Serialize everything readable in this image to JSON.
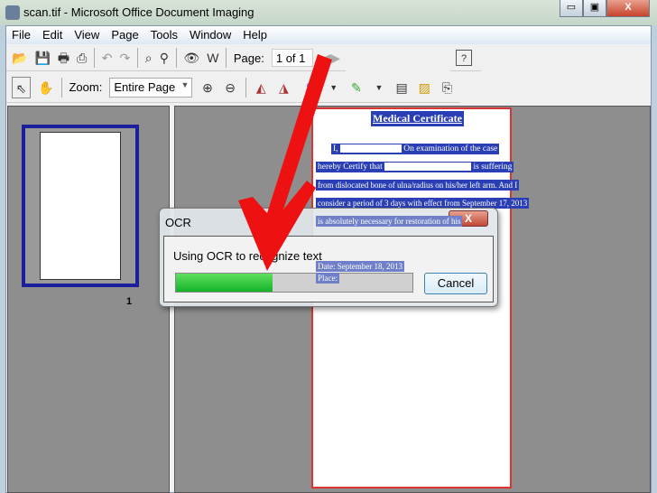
{
  "window": {
    "title": "scan.tif - Microsoft Office Document Imaging",
    "min": "▭",
    "max": "▣",
    "close": "X"
  },
  "menu": [
    "File",
    "Edit",
    "View",
    "Page",
    "Tools",
    "Window",
    "Help"
  ],
  "toolbar": {
    "page_label": "Page:",
    "page_value": "1 of 1",
    "zoom_label": "Zoom:",
    "zoom_value": "Entire Page"
  },
  "thumbnail": {
    "page_number": "1"
  },
  "document": {
    "title": "Medical Certificate",
    "lines": [
      "I,",
      "On examination of the case",
      "hereby Certify that",
      "is suffering",
      "from dislocated bone of ulna/radius on his/her left arm. And I",
      "consider a period of 3 days with effect from September 17, 2013",
      "is absolutely necessary for restoration of his"
    ],
    "footer": [
      "Date: September 18, 2013",
      "Place:"
    ]
  },
  "dialog": {
    "title": "OCR",
    "message": "Using OCR to recognize text",
    "progress_percent": 41,
    "cancel": "Cancel",
    "close": "X"
  },
  "colors": {
    "arrow": "#ee1111",
    "progress": "#1fbb33",
    "highlight": "#2a3fb5"
  }
}
